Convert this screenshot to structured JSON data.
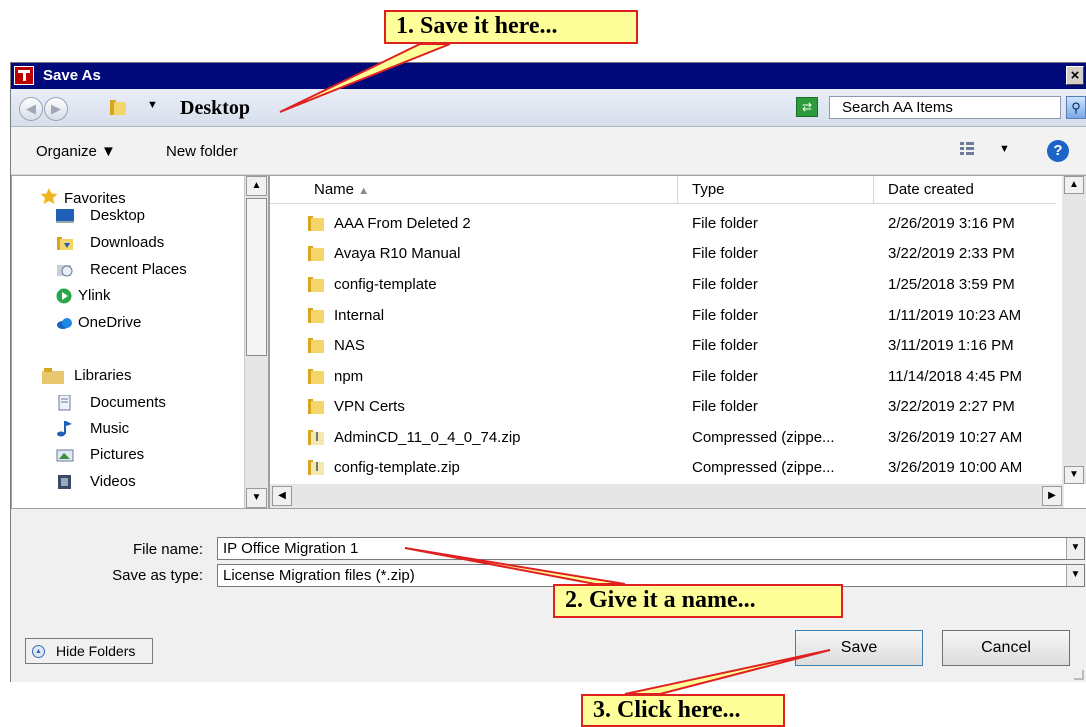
{
  "callouts": {
    "save_here": "1. Save it here...",
    "give_name": "2. Give it a name...",
    "click_here": "3. Click here..."
  },
  "colors": {
    "callout_fill": "#ffff99",
    "callout_border": "#e02020",
    "titlebar": "#000a7a"
  },
  "window": {
    "title": "Save As",
    "close": "×"
  },
  "address": {
    "location": "Desktop",
    "search_placeholder": "Search AA Items"
  },
  "toolbar": {
    "organize": "Organize ▼",
    "new_folder": "New folder"
  },
  "nav": {
    "favorites_header": "Favorites",
    "favorites": [
      "Desktop",
      "Downloads",
      "Recent Places",
      "Ylink",
      "OneDrive"
    ],
    "libraries_header": "Libraries",
    "libraries": [
      "Documents",
      "Music",
      "Pictures",
      "Videos"
    ]
  },
  "columns": {
    "name": "Name",
    "type": "Type",
    "date": "Date created"
  },
  "files": [
    {
      "name": "AAA From Deleted 2",
      "type": "File folder",
      "date": "2/26/2019 3:16 PM",
      "icon": "folder-icon"
    },
    {
      "name": "Avaya R10 Manual",
      "type": "File folder",
      "date": "3/22/2019 2:33 PM",
      "icon": "folder-icon"
    },
    {
      "name": "config-template",
      "type": "File folder",
      "date": "1/25/2018 3:59 PM",
      "icon": "folder-icon"
    },
    {
      "name": "Internal",
      "type": "File folder",
      "date": "1/11/2019 10:23 AM",
      "icon": "folder-icon"
    },
    {
      "name": "NAS",
      "type": "File folder",
      "date": "3/11/2019 1:16 PM",
      "icon": "folder-icon"
    },
    {
      "name": "npm",
      "type": "File folder",
      "date": "11/14/2018 4:45 PM",
      "icon": "folder-icon"
    },
    {
      "name": "VPN Certs",
      "type": "File folder",
      "date": "3/22/2019 2:27 PM",
      "icon": "folder-icon"
    },
    {
      "name": "AdminCD_11_0_4_0_74.zip",
      "type": "Compressed (zippe...",
      "date": "3/26/2019 10:27 AM",
      "icon": "zip-folder-icon"
    },
    {
      "name": "config-template.zip",
      "type": "Compressed (zippe...",
      "date": "3/26/2019 10:00 AM",
      "icon": "zip-folder-icon"
    }
  ],
  "form": {
    "filename_label": "File name:",
    "filename_value": "IP Office Migration 1",
    "savetype_label": "Save as type:",
    "savetype_value": "License Migration files (*.zip)"
  },
  "buttons": {
    "hide_folders": "Hide Folders",
    "save": "Save",
    "cancel": "Cancel"
  }
}
